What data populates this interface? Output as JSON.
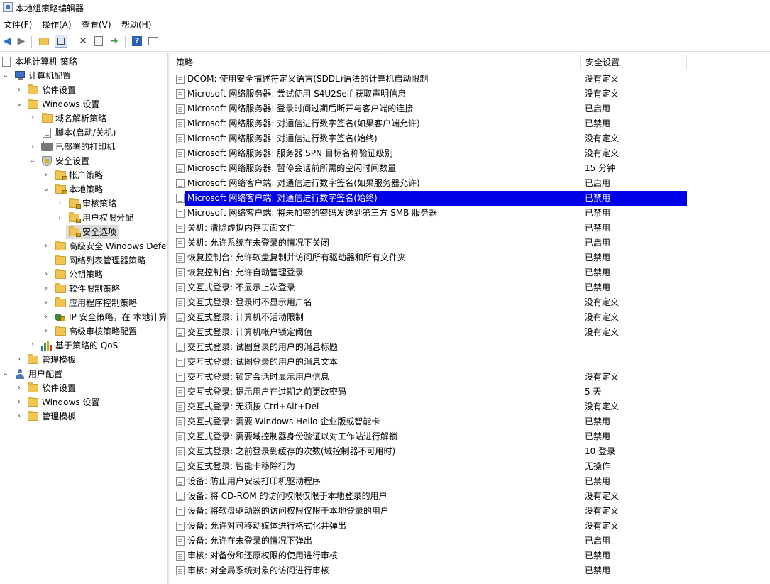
{
  "window": {
    "title": "本地组策略编辑器"
  },
  "menu": [
    "文件(F)",
    "操作(A)",
    "查看(V)",
    "帮助(H)"
  ],
  "toolbar": [
    "back-icon",
    "forward-icon",
    "up-folder-icon",
    "show-hide-tree-icon",
    "delete-icon",
    "properties-icon",
    "export-list-icon",
    "help-icon",
    "view-icon"
  ],
  "tree": {
    "root": "本地计算机 策略",
    "computer_config": "计算机配置",
    "software_settings": "软件设置",
    "windows_settings": "Windows 设置",
    "name_resolution": "域名解析策略",
    "scripts": "脚本(启动/关机)",
    "printers": "已部署的打印机",
    "security_settings": "安全设置",
    "account_policies": "帐户策略",
    "local_policies": "本地策略",
    "audit_policy": "审核策略",
    "user_rights": "用户权限分配",
    "security_options": "安全选项",
    "defender_firewall": "高级安全 Windows Defe",
    "network_list": "网络列表管理器策略",
    "public_key": "公钥策略",
    "software_restriction": "软件限制策略",
    "app_control": "应用程序控制策略",
    "ipsec": "IP 安全策略，在 本地计算",
    "advanced_audit": "高级审核策略配置",
    "qos": "基于策略的 QoS",
    "admin_templates": "管理模板",
    "user_config": "用户配置",
    "user_software_settings": "软件设置",
    "user_windows_settings": "Windows 设置",
    "user_admin_templates": "管理模板"
  },
  "list": {
    "columns": [
      "策略",
      "安全设置"
    ],
    "rows": [
      {
        "policy": "DCOM: 使用安全描述符定义语言(SDDL)语法的计算机启动限制",
        "setting": "没有定义"
      },
      {
        "policy": "Microsoft 网络服务器: 尝试使用 S4U2Self 获取声明信息",
        "setting": "没有定义"
      },
      {
        "policy": "Microsoft 网络服务器: 登录时间过期后断开与客户端的连接",
        "setting": "已启用"
      },
      {
        "policy": "Microsoft 网络服务器: 对通信进行数字签名(如果客户端允许)",
        "setting": "已禁用"
      },
      {
        "policy": "Microsoft 网络服务器: 对通信进行数字签名(始终)",
        "setting": "没有定义"
      },
      {
        "policy": "Microsoft 网络服务器: 服务器 SPN 目标名称验证级别",
        "setting": "没有定义"
      },
      {
        "policy": "Microsoft 网络服务器: 暂停会话前所需的空闲时间数量",
        "setting": "15 分钟"
      },
      {
        "policy": "Microsoft 网络客户端: 对通信进行数字签名(如果服务器允许)",
        "setting": "已启用"
      },
      {
        "policy": "Microsoft 网络客户端: 对通信进行数字签名(始终)",
        "setting": "已禁用",
        "selected": true
      },
      {
        "policy": "Microsoft 网络客户端: 将未加密的密码发送到第三方 SMB 服务器",
        "setting": "已禁用"
      },
      {
        "policy": "关机: 清除虚拟内存页面文件",
        "setting": "已禁用"
      },
      {
        "policy": "关机: 允许系统在未登录的情况下关闭",
        "setting": "已启用"
      },
      {
        "policy": "恢复控制台: 允许软盘复制并访问所有驱动器和所有文件夹",
        "setting": "已禁用"
      },
      {
        "policy": "恢复控制台: 允许自动管理登录",
        "setting": "已禁用"
      },
      {
        "policy": "交互式登录: 不显示上次登录",
        "setting": "已禁用"
      },
      {
        "policy": "交互式登录: 登录时不显示用户名",
        "setting": "没有定义"
      },
      {
        "policy": "交互式登录: 计算机不活动限制",
        "setting": "没有定义"
      },
      {
        "policy": "交互式登录: 计算机帐户锁定阈值",
        "setting": "没有定义"
      },
      {
        "policy": "交互式登录: 试图登录的用户的消息标题",
        "setting": ""
      },
      {
        "policy": "交互式登录: 试图登录的用户的消息文本",
        "setting": ""
      },
      {
        "policy": "交互式登录: 锁定会话时显示用户信息",
        "setting": "没有定义"
      },
      {
        "policy": "交互式登录: 提示用户在过期之前更改密码",
        "setting": "5 天"
      },
      {
        "policy": "交互式登录: 无须按 Ctrl+Alt+Del",
        "setting": "没有定义"
      },
      {
        "policy": "交互式登录: 需要 Windows Hello 企业版或智能卡",
        "setting": "已禁用"
      },
      {
        "policy": "交互式登录: 需要域控制器身份验证以对工作站进行解锁",
        "setting": "已禁用"
      },
      {
        "policy": "交互式登录: 之前登录到缓存的次数(域控制器不可用时)",
        "setting": "10 登录"
      },
      {
        "policy": "交互式登录: 智能卡移除行为",
        "setting": "无操作"
      },
      {
        "policy": "设备: 防止用户安装打印机驱动程序",
        "setting": "已禁用"
      },
      {
        "policy": "设备: 将 CD-ROM 的访问权限仅限于本地登录的用户",
        "setting": "没有定义"
      },
      {
        "policy": "设备: 将软盘驱动器的访问权限仅限于本地登录的用户",
        "setting": "没有定义"
      },
      {
        "policy": "设备: 允许对可移动媒体进行格式化并弹出",
        "setting": "没有定义"
      },
      {
        "policy": "设备: 允许在未登录的情况下弹出",
        "setting": "已启用"
      },
      {
        "policy": "审核: 对备份和还原权限的使用进行审核",
        "setting": "已禁用"
      },
      {
        "policy": "审核: 对全局系统对象的访问进行审核",
        "setting": "已禁用"
      }
    ]
  }
}
